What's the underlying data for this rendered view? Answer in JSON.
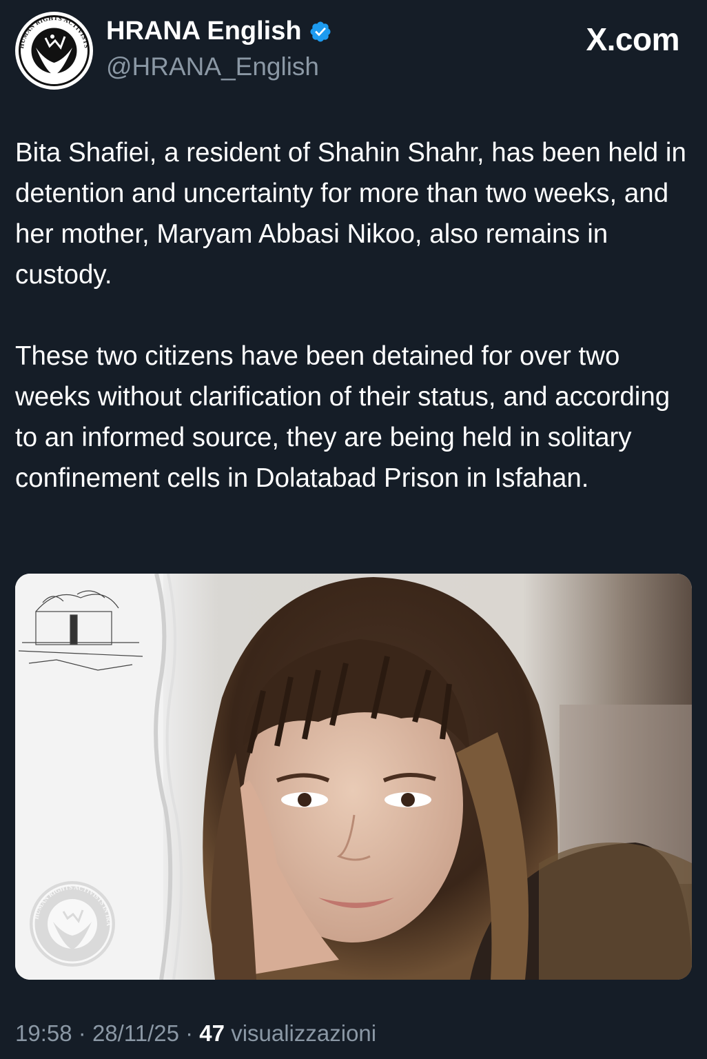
{
  "header": {
    "display_name": "HRANA English",
    "handle": "@HRANA_English",
    "verified": true,
    "verified_icon": "verified-badge-icon",
    "brand": "X.com",
    "avatar_icon": "hrana-logo-icon",
    "avatar_logo_text": "HUMAN RIGHTS ACTIVISTS IN IRAN"
  },
  "tweet": {
    "paragraphs": [
      "Bita Shafiei, a resident of Shahin Shahr, has been held in detention and uncertainty for more than two weeks, and her mother, Maryam Abbasi Nikoo, also remains in custody.",
      "These two citizens have been detained for over two weeks without clarification of their status, and according to an informed source, they are being held in solitary confinement cells in Dolatabad Prison in Isfahan."
    ]
  },
  "media": {
    "image_icon": "portrait-photo",
    "watermark_text": "HUMAN RIGHTS ACTIVISTS IN IRAN"
  },
  "meta": {
    "time": "19:58",
    "separator": "·",
    "date": "28/11/25",
    "views_count": "47",
    "views_label": "visualizzazioni"
  },
  "colors": {
    "background": "#151d27",
    "text_primary": "#ffffff",
    "text_secondary": "#8b98a5",
    "verified_blue": "#1d9bf0"
  }
}
